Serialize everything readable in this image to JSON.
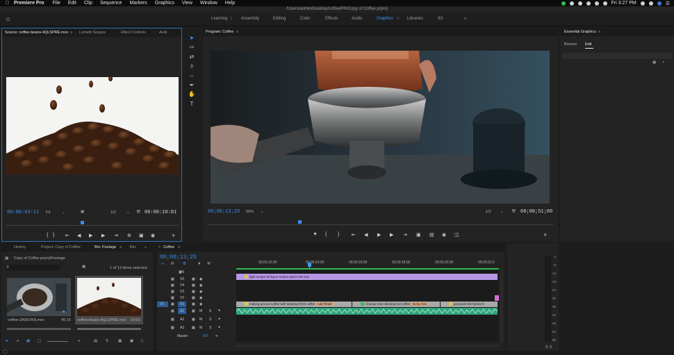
{
  "menubar": {
    "app": "Premiere Pro",
    "items": [
      "File",
      "Edit",
      "Clip",
      "Sequence",
      "Markers",
      "Graphics",
      "View",
      "Window",
      "Help"
    ],
    "clock": "Fri 3:27 PM"
  },
  "titlebar": {
    "path": "/Users/admin/Desktop/coffee/PR/Copy of Coffee.prproj"
  },
  "workspaces": {
    "items": [
      "Learning",
      "Assembly",
      "Editing",
      "Color",
      "Effects",
      "Audio",
      "Graphics",
      "Libraries",
      "IDI"
    ],
    "active": "Graphics",
    "overflow": "»"
  },
  "source": {
    "tabs": [
      "Source: coffee-beans-4QLSPRE.mov",
      "Lumetri Scopes",
      "Effect Controls",
      "Audi"
    ],
    "timecode": "00:00:04:11",
    "zoom": "Fit",
    "resolution": "1/2",
    "duration": "00:00:10:01"
  },
  "program": {
    "tab": "Program: Coffee",
    "timecode": "00;00;13;25",
    "zoom": "50%",
    "resolution": "1/2",
    "duration": "00;00;51;00"
  },
  "essential": {
    "title": "Essential Graphics",
    "tabs": [
      "Browse",
      "Edit"
    ],
    "active_tab": "Edit"
  },
  "project": {
    "tabs": [
      "History",
      "Project: Copy of Coffee",
      "Bin: Footage",
      "Bin:"
    ],
    "path": "Copy of Coffee.prproj\\Footage",
    "count": "1 of 13 items selected",
    "items": [
      {
        "name": "coffee-ZA9SVK8.mov",
        "duration": "45:15"
      },
      {
        "name": "coffee-beans-4QLSPRE.mov",
        "duration": "10:01"
      }
    ]
  },
  "timeline": {
    "tab": "Coffee",
    "timecode": "00;00;13;25",
    "ruler": [
      "00;00;12;00",
      "00;00;14;00",
      "00;00;16;00",
      "00;00;18;00",
      "00;00;20;00",
      "00;00;22;0"
    ],
    "source_patch": "V1",
    "tracks": [
      "V6",
      "V5",
      "V4",
      "V3",
      "V2",
      "V1",
      "A1",
      "A2",
      "A3"
    ],
    "master": "Master",
    "master_value": "0.0",
    "clips": {
      "v6": "light-scraps-of-fog-in-motion-Q4GJ73F.mov",
      "v1a": "making ground coffee with tamping fresh coffee",
      "v1a_tag": "Add Retail",
      "v1b": "closeup-man-drinking-hot coffee",
      "v1b_tag": "Ilu-by Alex",
      "v1c": "just-push-the-button-h"
    }
  },
  "meter": {
    "labels": [
      "0",
      "-6",
      "-12",
      "-18",
      "-24",
      "-30",
      "-36",
      "-42",
      "-48",
      "-54",
      "dB"
    ]
  },
  "colors": {
    "accent": "#3e9dfd",
    "v6_clip": "#b696e6",
    "v1_clip": "#a9a9a9",
    "a1_clip": "#2fa37a"
  }
}
